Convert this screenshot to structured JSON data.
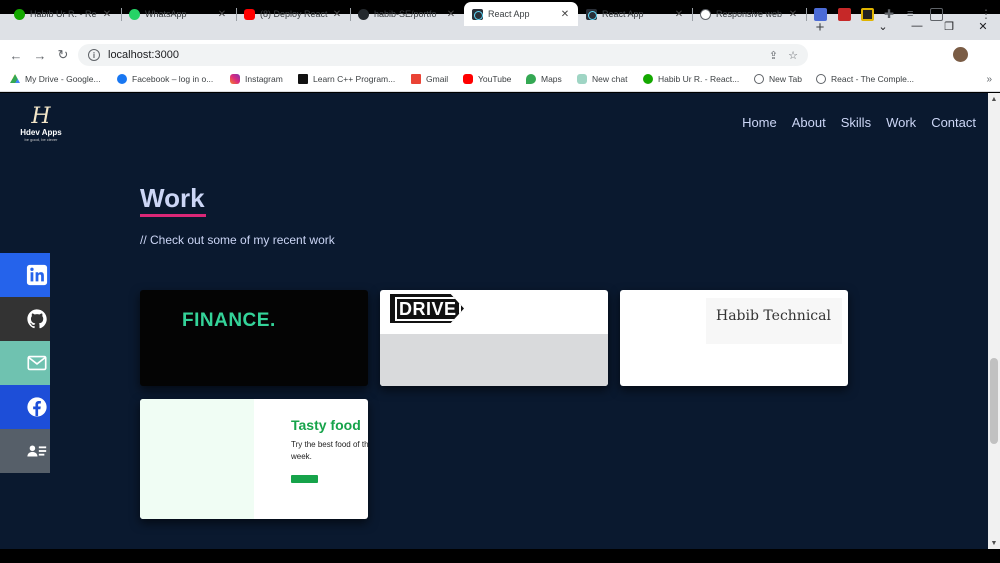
{
  "browser": {
    "tabs": [
      {
        "title": "Habib Ur R. - Re",
        "icon": "upwork-icon"
      },
      {
        "title": "WhatsApp",
        "icon": "whatsapp-icon"
      },
      {
        "title": "(8) Deploy React",
        "icon": "youtube-icon"
      },
      {
        "title": "habib-SE/portfo",
        "icon": "github-icon"
      },
      {
        "title": "React App",
        "icon": "react-icon",
        "active": true
      },
      {
        "title": "React App",
        "icon": "react-icon"
      },
      {
        "title": "Responsive web",
        "icon": "globe-icon"
      }
    ],
    "url": "localhost:3000",
    "bookmarks": [
      {
        "label": "My Drive - Google...",
        "icon": "drive-icon"
      },
      {
        "label": "Facebook – log in o...",
        "icon": "facebook-icon"
      },
      {
        "label": "Instagram",
        "icon": "instagram-icon"
      },
      {
        "label": "Learn C++ Program...",
        "icon": "code-icon"
      },
      {
        "label": "Gmail",
        "icon": "gmail-icon"
      },
      {
        "label": "YouTube",
        "icon": "youtube-icon"
      },
      {
        "label": "Maps",
        "icon": "maps-icon"
      },
      {
        "label": "New chat",
        "icon": "chat-icon"
      },
      {
        "label": "Habib Ur R. - React...",
        "icon": "upwork-icon"
      },
      {
        "label": "New Tab",
        "icon": "globe-icon"
      },
      {
        "label": "React - The Comple...",
        "icon": "globe-icon"
      }
    ],
    "bookmarks_more": "»"
  },
  "site": {
    "logo": {
      "mark": "H",
      "name": "Hdev Apps",
      "tagline": "be good, be clever"
    },
    "nav": [
      "Home",
      "About",
      "Skills",
      "Work",
      "Contact"
    ],
    "section_title": "Work",
    "section_subtitle": "// Check out some of my recent work",
    "projects": [
      {
        "image_text": "FINANCE."
      },
      {
        "image_text": "DRIVE"
      },
      {
        "image_text": "Habib Technical"
      },
      {
        "image_text": "Tasty food",
        "image_subtext": "Try the best food of the week."
      }
    ],
    "social": [
      {
        "icon": "linkedin-icon",
        "color": "#2563eb"
      },
      {
        "icon": "github-icon",
        "color": "#333333"
      },
      {
        "icon": "mail-icon",
        "color": "#6fc2b0"
      },
      {
        "icon": "facebook-icon",
        "color": "#1d4ed8"
      },
      {
        "icon": "resume-icon",
        "color": "#565f69"
      }
    ]
  },
  "colors": {
    "background": "#0a192f",
    "text": "#ccd6f6",
    "accent": "#db2777"
  }
}
